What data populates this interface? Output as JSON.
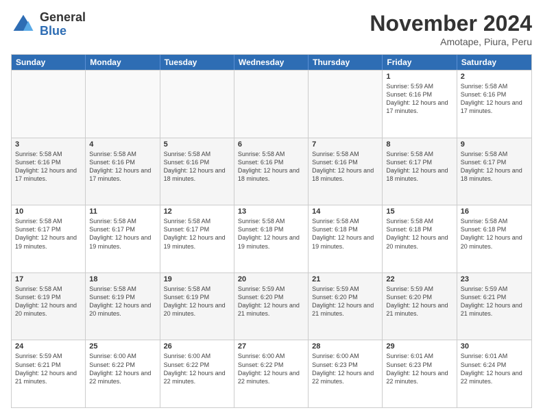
{
  "logo": {
    "general": "General",
    "blue": "Blue"
  },
  "header": {
    "month": "November 2024",
    "location": "Amotape, Piura, Peru"
  },
  "weekdays": [
    "Sunday",
    "Monday",
    "Tuesday",
    "Wednesday",
    "Thursday",
    "Friday",
    "Saturday"
  ],
  "weeks": [
    [
      {
        "day": "",
        "info": ""
      },
      {
        "day": "",
        "info": ""
      },
      {
        "day": "",
        "info": ""
      },
      {
        "day": "",
        "info": ""
      },
      {
        "day": "",
        "info": ""
      },
      {
        "day": "1",
        "info": "Sunrise: 5:59 AM\nSunset: 6:16 PM\nDaylight: 12 hours and 17 minutes."
      },
      {
        "day": "2",
        "info": "Sunrise: 5:58 AM\nSunset: 6:16 PM\nDaylight: 12 hours and 17 minutes."
      }
    ],
    [
      {
        "day": "3",
        "info": "Sunrise: 5:58 AM\nSunset: 6:16 PM\nDaylight: 12 hours and 17 minutes."
      },
      {
        "day": "4",
        "info": "Sunrise: 5:58 AM\nSunset: 6:16 PM\nDaylight: 12 hours and 17 minutes."
      },
      {
        "day": "5",
        "info": "Sunrise: 5:58 AM\nSunset: 6:16 PM\nDaylight: 12 hours and 18 minutes."
      },
      {
        "day": "6",
        "info": "Sunrise: 5:58 AM\nSunset: 6:16 PM\nDaylight: 12 hours and 18 minutes."
      },
      {
        "day": "7",
        "info": "Sunrise: 5:58 AM\nSunset: 6:16 PM\nDaylight: 12 hours and 18 minutes."
      },
      {
        "day": "8",
        "info": "Sunrise: 5:58 AM\nSunset: 6:17 PM\nDaylight: 12 hours and 18 minutes."
      },
      {
        "day": "9",
        "info": "Sunrise: 5:58 AM\nSunset: 6:17 PM\nDaylight: 12 hours and 18 minutes."
      }
    ],
    [
      {
        "day": "10",
        "info": "Sunrise: 5:58 AM\nSunset: 6:17 PM\nDaylight: 12 hours and 19 minutes."
      },
      {
        "day": "11",
        "info": "Sunrise: 5:58 AM\nSunset: 6:17 PM\nDaylight: 12 hours and 19 minutes."
      },
      {
        "day": "12",
        "info": "Sunrise: 5:58 AM\nSunset: 6:17 PM\nDaylight: 12 hours and 19 minutes."
      },
      {
        "day": "13",
        "info": "Sunrise: 5:58 AM\nSunset: 6:18 PM\nDaylight: 12 hours and 19 minutes."
      },
      {
        "day": "14",
        "info": "Sunrise: 5:58 AM\nSunset: 6:18 PM\nDaylight: 12 hours and 19 minutes."
      },
      {
        "day": "15",
        "info": "Sunrise: 5:58 AM\nSunset: 6:18 PM\nDaylight: 12 hours and 20 minutes."
      },
      {
        "day": "16",
        "info": "Sunrise: 5:58 AM\nSunset: 6:18 PM\nDaylight: 12 hours and 20 minutes."
      }
    ],
    [
      {
        "day": "17",
        "info": "Sunrise: 5:58 AM\nSunset: 6:19 PM\nDaylight: 12 hours and 20 minutes."
      },
      {
        "day": "18",
        "info": "Sunrise: 5:58 AM\nSunset: 6:19 PM\nDaylight: 12 hours and 20 minutes."
      },
      {
        "day": "19",
        "info": "Sunrise: 5:58 AM\nSunset: 6:19 PM\nDaylight: 12 hours and 20 minutes."
      },
      {
        "day": "20",
        "info": "Sunrise: 5:59 AM\nSunset: 6:20 PM\nDaylight: 12 hours and 21 minutes."
      },
      {
        "day": "21",
        "info": "Sunrise: 5:59 AM\nSunset: 6:20 PM\nDaylight: 12 hours and 21 minutes."
      },
      {
        "day": "22",
        "info": "Sunrise: 5:59 AM\nSunset: 6:20 PM\nDaylight: 12 hours and 21 minutes."
      },
      {
        "day": "23",
        "info": "Sunrise: 5:59 AM\nSunset: 6:21 PM\nDaylight: 12 hours and 21 minutes."
      }
    ],
    [
      {
        "day": "24",
        "info": "Sunrise: 5:59 AM\nSunset: 6:21 PM\nDaylight: 12 hours and 21 minutes."
      },
      {
        "day": "25",
        "info": "Sunrise: 6:00 AM\nSunset: 6:22 PM\nDaylight: 12 hours and 22 minutes."
      },
      {
        "day": "26",
        "info": "Sunrise: 6:00 AM\nSunset: 6:22 PM\nDaylight: 12 hours and 22 minutes."
      },
      {
        "day": "27",
        "info": "Sunrise: 6:00 AM\nSunset: 6:22 PM\nDaylight: 12 hours and 22 minutes."
      },
      {
        "day": "28",
        "info": "Sunrise: 6:00 AM\nSunset: 6:23 PM\nDaylight: 12 hours and 22 minutes."
      },
      {
        "day": "29",
        "info": "Sunrise: 6:01 AM\nSunset: 6:23 PM\nDaylight: 12 hours and 22 minutes."
      },
      {
        "day": "30",
        "info": "Sunrise: 6:01 AM\nSunset: 6:24 PM\nDaylight: 12 hours and 22 minutes."
      }
    ]
  ]
}
